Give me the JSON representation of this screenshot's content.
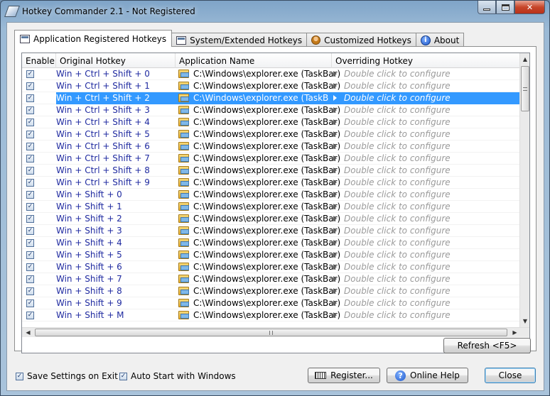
{
  "window": {
    "title": "Hotkey Commander 2.1 - Not Registered",
    "caption_buttons": {
      "minimize": "minimize",
      "maximize": "maximize",
      "close": "✕"
    }
  },
  "tabs": [
    {
      "label": "Application Registered Hotkeys",
      "icon": "window-icon",
      "active": true
    },
    {
      "label": "System/Extended Hotkeys",
      "icon": "window-icon",
      "active": false
    },
    {
      "label": "Customized Hotkeys",
      "icon": "person-icon",
      "active": false
    },
    {
      "label": "About",
      "icon": "info-icon",
      "active": false
    }
  ],
  "grid": {
    "columns": [
      "Enable",
      "Original Hotkey",
      "Application Name",
      "Overriding Hotkey"
    ],
    "selected_row": 2,
    "rows": [
      {
        "enabled": true,
        "hotkey": "Win + Ctrl + Shift + 0",
        "app": "C:\\Windows\\explorer.exe (TaskBar)",
        "override": "Double click to configure"
      },
      {
        "enabled": true,
        "hotkey": "Win + Ctrl + Shift + 1",
        "app": "C:\\Windows\\explorer.exe (TaskBar)",
        "override": "Double click to configure"
      },
      {
        "enabled": true,
        "hotkey": "Win + Ctrl + Shift + 2",
        "app": "C:\\Windows\\explorer.exe (TaskBar)",
        "override": "Double click to configure"
      },
      {
        "enabled": true,
        "hotkey": "Win + Ctrl + Shift + 3",
        "app": "C:\\Windows\\explorer.exe (TaskBar)",
        "override": "Double click to configure"
      },
      {
        "enabled": true,
        "hotkey": "Win + Ctrl + Shift + 4",
        "app": "C:\\Windows\\explorer.exe (TaskBar)",
        "override": "Double click to configure"
      },
      {
        "enabled": true,
        "hotkey": "Win + Ctrl + Shift + 5",
        "app": "C:\\Windows\\explorer.exe (TaskBar)",
        "override": "Double click to configure"
      },
      {
        "enabled": true,
        "hotkey": "Win + Ctrl + Shift + 6",
        "app": "C:\\Windows\\explorer.exe (TaskBar)",
        "override": "Double click to configure"
      },
      {
        "enabled": true,
        "hotkey": "Win + Ctrl + Shift + 7",
        "app": "C:\\Windows\\explorer.exe (TaskBar)",
        "override": "Double click to configure"
      },
      {
        "enabled": true,
        "hotkey": "Win + Ctrl + Shift + 8",
        "app": "C:\\Windows\\explorer.exe (TaskBar)",
        "override": "Double click to configure"
      },
      {
        "enabled": true,
        "hotkey": "Win + Ctrl + Shift + 9",
        "app": "C:\\Windows\\explorer.exe (TaskBar)",
        "override": "Double click to configure"
      },
      {
        "enabled": true,
        "hotkey": "Win + Shift + 0",
        "app": "C:\\Windows\\explorer.exe (TaskBar)",
        "override": "Double click to configure"
      },
      {
        "enabled": true,
        "hotkey": "Win + Shift + 1",
        "app": "C:\\Windows\\explorer.exe (TaskBar)",
        "override": "Double click to configure"
      },
      {
        "enabled": true,
        "hotkey": "Win + Shift + 2",
        "app": "C:\\Windows\\explorer.exe (TaskBar)",
        "override": "Double click to configure"
      },
      {
        "enabled": true,
        "hotkey": "Win + Shift + 3",
        "app": "C:\\Windows\\explorer.exe (TaskBar)",
        "override": "Double click to configure"
      },
      {
        "enabled": true,
        "hotkey": "Win + Shift + 4",
        "app": "C:\\Windows\\explorer.exe (TaskBar)",
        "override": "Double click to configure"
      },
      {
        "enabled": true,
        "hotkey": "Win + Shift + 5",
        "app": "C:\\Windows\\explorer.exe (TaskBar)",
        "override": "Double click to configure"
      },
      {
        "enabled": true,
        "hotkey": "Win + Shift + 6",
        "app": "C:\\Windows\\explorer.exe (TaskBar)",
        "override": "Double click to configure"
      },
      {
        "enabled": true,
        "hotkey": "Win + Shift + 7",
        "app": "C:\\Windows\\explorer.exe (TaskBar)",
        "override": "Double click to configure"
      },
      {
        "enabled": true,
        "hotkey": "Win + Shift + 8",
        "app": "C:\\Windows\\explorer.exe (TaskBar)",
        "override": "Double click to configure"
      },
      {
        "enabled": true,
        "hotkey": "Win + Shift + 9",
        "app": "C:\\Windows\\explorer.exe (TaskBar)",
        "override": "Double click to configure"
      },
      {
        "enabled": true,
        "hotkey": "Win + Shift + M",
        "app": "C:\\Windows\\explorer.exe (TaskBar)",
        "override": "Double click to configure"
      }
    ]
  },
  "buttons": {
    "refresh": "Refresh <F5>",
    "register": "Register...",
    "online_help": "Online Help",
    "close": "Close"
  },
  "options": {
    "save_settings": {
      "label": "Save Settings on Exit",
      "checked": true
    },
    "auto_start": {
      "label": "Auto Start with Windows",
      "checked": true
    }
  },
  "colors": {
    "selection": "#3399ff",
    "hotkey_text": "#1f2aa0",
    "placeholder_text": "#9a9a9a"
  }
}
